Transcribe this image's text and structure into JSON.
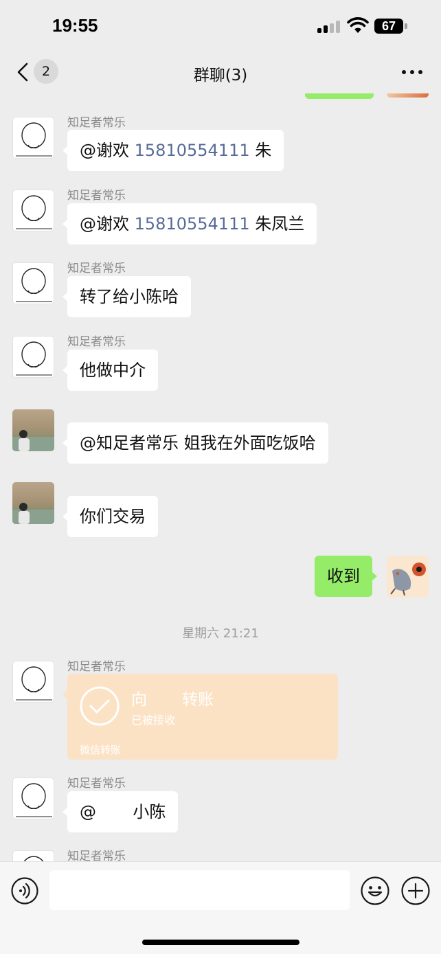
{
  "status_bar": {
    "time": "19:55",
    "battery": "67"
  },
  "header": {
    "back_badge": "2",
    "title": "群聊(3)"
  },
  "messages": [
    {
      "sender": "知足者常乐",
      "prefix": "@谢欢 ",
      "phone": "15810554111",
      "suffix": " 朱"
    },
    {
      "sender": "知足者常乐",
      "prefix": "@谢欢 ",
      "phone": "15810554111",
      "suffix": " 朱凤兰"
    },
    {
      "sender": "知足者常乐",
      "text": "转了给小陈哈"
    },
    {
      "sender": "知足者常乐",
      "text": "他做中介"
    },
    {
      "sender": "",
      "text": "@知足者常乐 姐我在外面吃饭哈"
    },
    {
      "sender": "",
      "text": "你们交易"
    },
    {
      "sender": "",
      "text": "收到"
    },
    {
      "sender": "知足者常乐",
      "text": "@       小陈"
    },
    {
      "sender": "知足者常乐"
    }
  ],
  "time_separator": "星期六 21:21",
  "transfer": {
    "title": "向       转账",
    "status": "已被接收",
    "footer": "微信转账"
  },
  "colors": {
    "self_bubble": "#95ec69",
    "transfer_card": "#fce2c5",
    "link": "#576b95"
  },
  "icons": {
    "voice": "voice-icon",
    "emoji": "emoji-icon",
    "plus": "plus-icon",
    "back": "chevron-left-icon",
    "more": "more-icon"
  }
}
